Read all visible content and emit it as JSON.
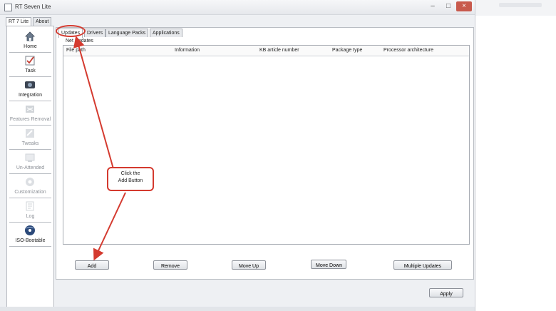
{
  "window": {
    "title": "RT Seven Lite"
  },
  "left_tabs": [
    {
      "label": "RT 7 Lite",
      "active": true
    },
    {
      "label": "About",
      "active": false
    }
  ],
  "sidebar": {
    "items": [
      {
        "label": "Home",
        "icon": "home-icon",
        "enabled": true
      },
      {
        "label": "Task",
        "icon": "task-checklist-icon",
        "enabled": true
      },
      {
        "label": "Integration",
        "icon": "integration-icon",
        "enabled": true
      },
      {
        "label": "Features Removal",
        "icon": "features-removal-icon",
        "enabled": false
      },
      {
        "label": "Tweaks",
        "icon": "tweaks-icon",
        "enabled": false
      },
      {
        "label": "Un-Attended",
        "icon": "unattended-icon",
        "enabled": false
      },
      {
        "label": "Customization",
        "icon": "customization-icon",
        "enabled": false
      },
      {
        "label": "Log",
        "icon": "log-icon",
        "enabled": false
      },
      {
        "label": "ISO-Bootable",
        "icon": "iso-disc-icon",
        "enabled": true
      }
    ]
  },
  "tabs": [
    {
      "label": "Updates",
      "active": true
    },
    {
      "label": "Drivers",
      "active": false
    },
    {
      "label": "Language Packs",
      "active": false
    },
    {
      "label": "Applications",
      "active": false
    }
  ],
  "subtitle": "Net Updates",
  "table": {
    "columns": [
      "File path",
      "Information",
      "KB article number",
      "Package type",
      "Processor architecture"
    ],
    "rows": []
  },
  "buttons": {
    "add": "Add",
    "remove": "Remove",
    "move_up": "Move Up",
    "move_down": "Move Down",
    "multiple_updates": "Multiple Updates",
    "apply": "Apply"
  },
  "annotation": {
    "line1": "Click the",
    "line2": "Add Button",
    "color": "#d43a2f"
  }
}
